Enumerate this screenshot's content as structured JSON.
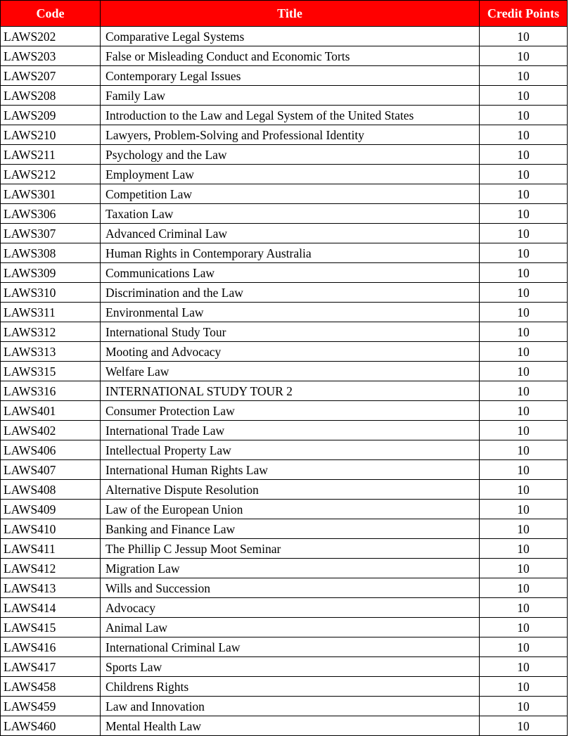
{
  "table": {
    "columns": [
      {
        "key": "code",
        "label": "Code"
      },
      {
        "key": "title",
        "label": "Title"
      },
      {
        "key": "credits",
        "label": "Credit Points"
      }
    ],
    "header_background": "#FF0000",
    "header_text_color": "#FFFFFF",
    "border_color": "#000000",
    "rows": [
      {
        "code": "LAWS202",
        "title": "Comparative Legal Systems",
        "credits": "10"
      },
      {
        "code": "LAWS203",
        "title": "False or Misleading Conduct and Economic Torts",
        "credits": "10"
      },
      {
        "code": "LAWS207",
        "title": "Contemporary Legal Issues",
        "credits": "10"
      },
      {
        "code": "LAWS208",
        "title": "Family Law",
        "credits": "10"
      },
      {
        "code": "LAWS209",
        "title": "Introduction to the Law and Legal System of the United States",
        "credits": "10"
      },
      {
        "code": "LAWS210",
        "title": "Lawyers, Problem-Solving and Professional Identity",
        "credits": "10"
      },
      {
        "code": "LAWS211",
        "title": "Psychology and the Law",
        "credits": "10"
      },
      {
        "code": "LAWS212",
        "title": "Employment Law",
        "credits": "10"
      },
      {
        "code": "LAWS301",
        "title": "Competition Law",
        "credits": "10"
      },
      {
        "code": "LAWS306",
        "title": "Taxation Law",
        "credits": "10"
      },
      {
        "code": "LAWS307",
        "title": "Advanced Criminal Law",
        "credits": "10"
      },
      {
        "code": "LAWS308",
        "title": "Human Rights in Contemporary Australia",
        "credits": "10"
      },
      {
        "code": "LAWS309",
        "title": "Communications Law",
        "credits": "10"
      },
      {
        "code": "LAWS310",
        "title": "Discrimination and the Law",
        "credits": "10"
      },
      {
        "code": "LAWS311",
        "title": "Environmental Law",
        "credits": "10"
      },
      {
        "code": "LAWS312",
        "title": "International Study Tour",
        "credits": "10"
      },
      {
        "code": "LAWS313",
        "title": "Mooting and Advocacy",
        "credits": "10"
      },
      {
        "code": "LAWS315",
        "title": "Welfare Law",
        "credits": "10"
      },
      {
        "code": "LAWS316",
        "title": "INTERNATIONAL STUDY TOUR 2",
        "credits": "10"
      },
      {
        "code": "LAWS401",
        "title": "Consumer Protection Law",
        "credits": "10"
      },
      {
        "code": "LAWS402",
        "title": "International Trade Law",
        "credits": "10"
      },
      {
        "code": "LAWS406",
        "title": "Intellectual Property Law",
        "credits": "10"
      },
      {
        "code": "LAWS407",
        "title": "International Human Rights Law",
        "credits": "10"
      },
      {
        "code": "LAWS408",
        "title": "Alternative Dispute Resolution",
        "credits": "10"
      },
      {
        "code": "LAWS409",
        "title": "Law of the European Union",
        "credits": "10"
      },
      {
        "code": "LAWS410",
        "title": "Banking and Finance Law",
        "credits": "10"
      },
      {
        "code": "LAWS411",
        "title": "The Phillip C Jessup Moot Seminar",
        "credits": "10"
      },
      {
        "code": "LAWS412",
        "title": "Migration Law",
        "credits": "10"
      },
      {
        "code": "LAWS413",
        "title": "Wills and Succession",
        "credits": "10"
      },
      {
        "code": "LAWS414",
        "title": "Advocacy",
        "credits": "10"
      },
      {
        "code": "LAWS415",
        "title": "Animal Law",
        "credits": "10"
      },
      {
        "code": "LAWS416",
        "title": "International Criminal Law",
        "credits": "10"
      },
      {
        "code": "LAWS417",
        "title": "Sports Law",
        "credits": "10"
      },
      {
        "code": "LAWS458",
        "title": "Childrens Rights",
        "credits": "10"
      },
      {
        "code": "LAWS459",
        "title": "Law and Innovation",
        "credits": "10"
      },
      {
        "code": "LAWS460",
        "title": "Mental Health Law",
        "credits": "10"
      }
    ]
  }
}
